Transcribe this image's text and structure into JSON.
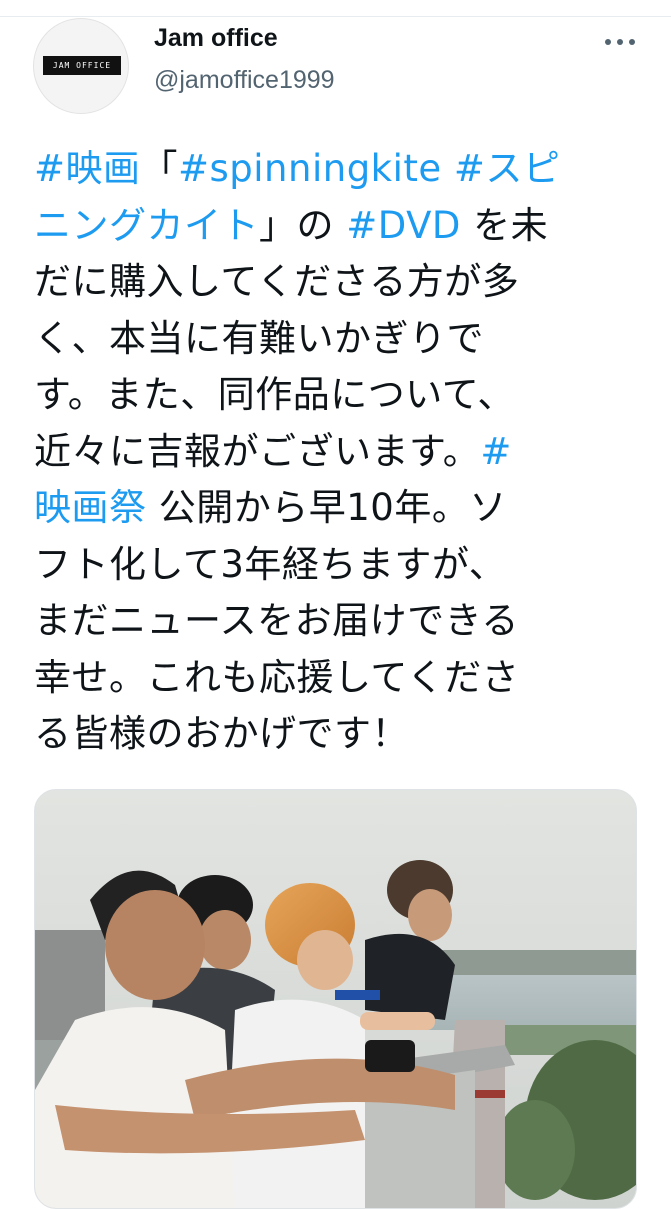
{
  "tweet": {
    "author": {
      "display_name": "Jam office",
      "handle": "@jamoffice1999",
      "avatar_text": "JAM OFFICE"
    },
    "text_lines": [
      [
        {
          "t": "#映画",
          "link": true
        },
        {
          "t": "「",
          "link": false
        },
        {
          "t": "#spinningkite",
          "link": true
        },
        {
          "t": " ",
          "link": false
        },
        {
          "t": "#スピ",
          "link": true
        }
      ],
      [
        {
          "t": "ニングカイト",
          "link": true
        },
        {
          "t": "」の ",
          "link": false
        },
        {
          "t": "#DVD",
          "link": true
        },
        {
          "t": " を未",
          "link": false
        }
      ],
      [
        {
          "t": "だに購入してくださる方が多",
          "link": false
        }
      ],
      [
        {
          "t": "く、本当に有難いかぎりで",
          "link": false
        }
      ],
      [
        {
          "t": "す。また、同作品について、",
          "link": false
        }
      ],
      [
        {
          "t": "近々に吉報がございます。",
          "link": false
        },
        {
          "t": "#",
          "link": true
        }
      ],
      [
        {
          "t": "映画祭",
          "link": true
        },
        {
          "t": " 公開から早10年。ソ",
          "link": false
        }
      ],
      [
        {
          "t": "フト化して3年経ちますが、",
          "link": false
        }
      ],
      [
        {
          "t": "まだニュースをお届けできる",
          "link": false
        }
      ],
      [
        {
          "t": "幸せ。これも応援してくださ",
          "link": false
        }
      ],
      [
        {
          "t": "る皆様のおかげです！",
          "link": false
        }
      ]
    ]
  },
  "colors": {
    "link": "#1d9bf0",
    "text": "#0f1419",
    "secondary": "#536471"
  },
  "icons": {
    "more": "more-horizontal-icon"
  }
}
